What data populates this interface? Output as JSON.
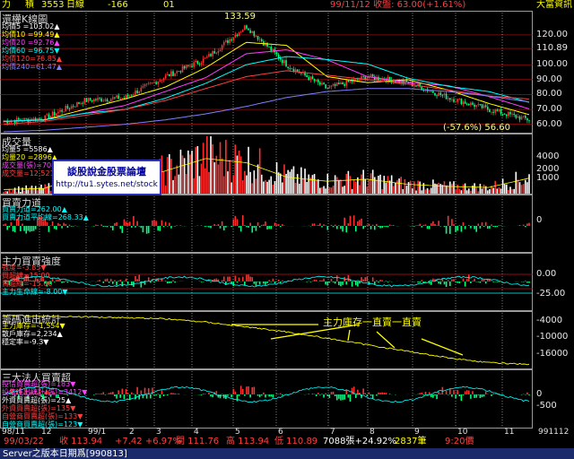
{
  "header": {
    "title_prefix": "力",
    "title_mid": "積",
    "code": "3553",
    "period": "日線",
    "field1": "-166",
    "field2": "01",
    "date_info": "99/11/12 收盤: 63.00(+1.61%)",
    "brand": "大富資訊"
  },
  "price_panel": {
    "title": "還權K線圖",
    "legend": [
      {
        "text": "均價5 =103.02▲",
        "color": "#ffffff"
      },
      {
        "text": "均價10 =99.49▲",
        "color": "#ffff00"
      },
      {
        "text": "均價20 =92.76▲",
        "color": "#ff40ff"
      },
      {
        "text": "均價60 =96.75▼",
        "color": "#00ffff"
      },
      {
        "text": "均價120=76.85▲",
        "color": "#ff4040"
      },
      {
        "text": "均價240=61.47▲",
        "color": "#8080ff"
      }
    ],
    "peak_label": "133.59",
    "low_label": "(-57.6%) 56.60",
    "y_labels": [
      "120.00",
      "110.89",
      "100.00",
      "90.00",
      "80.00",
      "70.00",
      "60.00"
    ],
    "grid_values": [
      120,
      110.89,
      100,
      90,
      80,
      70,
      60
    ]
  },
  "volume_panel": {
    "title": "成交量",
    "legend": [
      {
        "text": "均量5 =5586▲",
        "color": "#ffffff"
      },
      {
        "text": "均量20 =2896▲",
        "color": "#ffff00"
      },
      {
        "text": "成交量(張)=708",
        "color": "#ff40ff"
      },
      {
        "text": "成交量=12,521",
        "color": "#ff4040"
      }
    ],
    "y_labels": [
      "4000",
      "2000",
      "1000"
    ],
    "watermark_line1": "談股說金股票論壇",
    "watermark_line2": "http://tu1.sytes.net/stock"
  },
  "buysell_panel": {
    "title": "買賣力道",
    "legend": [
      {
        "text": "買賣力道=262.00▲",
        "color": "#00ffff"
      },
      {
        "text": "買賣力道平均線=268.33▲",
        "color": "#00ffff"
      }
    ],
    "y_labels": [
      "0"
    ]
  },
  "main_force_panel": {
    "title": "主力買賣強度",
    "legend": [
      {
        "text": "強度=-3.85▼",
        "color": "#ff4040"
      },
      {
        "text": "買超線=15.00",
        "color": "#ff4040"
      },
      {
        "text": "賣超線=-15.00",
        "color": "#ff4040"
      },
      {
        "text": "主力生命線=-8.00▼",
        "color": "#00ffff"
      }
    ],
    "y_labels": [
      "0.00",
      "-25.00"
    ]
  },
  "inventory_panel": {
    "title": "籌碼進出統計",
    "legend": [
      {
        "text": "主力庫存=-1,554▼",
        "color": "#ffff00"
      },
      {
        "text": "散戶庫存=2,234▲",
        "color": "#ffffff"
      },
      {
        "text": "穩定率=-9.3▼",
        "color": "#ffffff"
      }
    ],
    "y_labels": [
      "-4000",
      "-10000",
      "-16000"
    ],
    "annotation": "主力庫存一直賣一直賣"
  },
  "institutional_panel": {
    "title": "三大法人買賣超",
    "legend": [
      {
        "text": "投信買賣超(張)=183▼",
        "color": "#ff40ff"
      },
      {
        "text": "投信進出統計(張)=3412▼",
        "color": "#ff40ff"
      },
      {
        "text": "外資買賣超(張)=25▲",
        "color": "#ffffff"
      },
      {
        "text": "外資買賣超(張)=135▼",
        "color": "#ff4040"
      },
      {
        "text": "自營商買賣超(張)=133▼",
        "color": "#ff4040"
      },
      {
        "text": "自營商買賣超(張)=123▼",
        "color": "#00ffff"
      }
    ],
    "y_labels": [
      "0",
      "-500"
    ]
  },
  "x_axis": {
    "start": "98/11",
    "labels": [
      "12",
      "99/1",
      "2",
      "3",
      "4",
      "5",
      "6",
      "7",
      "8",
      "9",
      "10",
      "11"
    ],
    "end": "991112"
  },
  "status_bar": {
    "date": "99/03/22",
    "close": "收 113.94",
    "change": "+7.42 +6.97%",
    "open": "開 111.76",
    "high": "高 113.94",
    "low": "低 110.89",
    "volume": "7088張+24.92%",
    "trades": "2837筆",
    "time": "9:20價"
  },
  "bottom_bar": {
    "text": "Server之版本日期爲[990813]"
  },
  "colors": {
    "up": "#ff3030",
    "down": "#00ff80",
    "ma5": "#ffffff",
    "ma10": "#ffff00",
    "ma20": "#ff40ff",
    "ma60": "#00ffff",
    "ma120": "#ff4040",
    "ma240": "#8080ff",
    "grid_red": "#c01010",
    "border": "#9a9a9a"
  },
  "chart_data": [
    {
      "type": "line",
      "name": "還權K線圖",
      "description_series": "close",
      "x": [
        "98/11",
        "12",
        "99/1",
        "2",
        "3",
        "4",
        "5",
        "6",
        "7",
        "8",
        "9",
        "10",
        "11",
        "991112"
      ],
      "series": [
        {
          "name": "close",
          "values": [
            62,
            64,
            76,
            78,
            92,
            104,
            126,
            100,
            84,
            92,
            88,
            78,
            70,
            63
          ]
        },
        {
          "name": "均價120",
          "values": [
            60,
            62,
            66,
            70,
            76,
            84,
            92,
            96,
            93,
            90,
            87,
            83,
            79,
            77
          ]
        },
        {
          "name": "均價240",
          "values": [
            55,
            56,
            58,
            60,
            63,
            67,
            72,
            78,
            82,
            84,
            84,
            82,
            79,
            75
          ]
        }
      ],
      "ylim": [
        55,
        135
      ],
      "annotations": [
        {
          "label": "133.59",
          "x": "5",
          "y": 133.59
        },
        {
          "label": "(-57.6%) 56.60",
          "x": "991112",
          "y": 56.6
        }
      ]
    },
    {
      "type": "bar",
      "name": "成交量",
      "x": [
        "98/11",
        "12",
        "99/1",
        "2",
        "3",
        "4",
        "5",
        "6",
        "7",
        "8",
        "9",
        "10",
        "11",
        "991112"
      ],
      "values": [
        400,
        500,
        1800,
        1200,
        2200,
        3400,
        3000,
        1600,
        1200,
        1400,
        900,
        700,
        600,
        1500
      ],
      "ylim": [
        0,
        5000
      ]
    },
    {
      "type": "line",
      "name": "籌碼進出統計",
      "series": [
        {
          "name": "主力庫存",
          "values": [
            -2000,
            -2200,
            -2400,
            -2600,
            -3000,
            -4000,
            -5500,
            -7000,
            -9000,
            -11000,
            -13000,
            -15000,
            -16500,
            -17000
          ]
        }
      ],
      "x": [
        "98/11",
        "12",
        "99/1",
        "2",
        "3",
        "4",
        "5",
        "6",
        "7",
        "8",
        "9",
        "10",
        "11",
        "991112"
      ],
      "ylim": [
        -18000,
        -2000
      ]
    }
  ]
}
